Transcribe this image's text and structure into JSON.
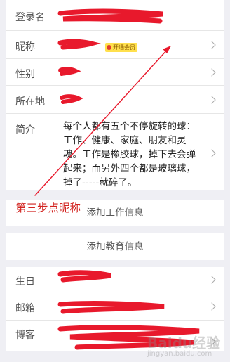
{
  "profile": {
    "login": {
      "label": "登录名"
    },
    "nickname": {
      "label": "昵称",
      "vip_badge": "开通会员"
    },
    "gender": {
      "label": "性别"
    },
    "location": {
      "label": "所在地"
    },
    "bio": {
      "label": "简介",
      "text": "每个人都有五个不停旋转的球：工作、健康、家庭、朋友和灵魂。工作是橡胶球，掉下去会弹起来；而另外四个都是玻璃球，掉了-----就碎了。"
    }
  },
  "actions": {
    "add_work": "添加工作信息",
    "add_education": "添加教育信息"
  },
  "details": {
    "birthday": {
      "label": "生日"
    },
    "email": {
      "label": "邮箱"
    },
    "blog": {
      "label": "博客"
    }
  },
  "annotation": {
    "text": "第三步点昵称",
    "color": "#d2231f"
  },
  "watermark": {
    "text": "Baidu经验",
    "sub": "jingyan.baidu.com"
  },
  "colors": {
    "background": "#efeff4",
    "scribble": "#e8192c"
  },
  "icons": {
    "chevron": "chevron-right-icon",
    "vip": "crown-icon"
  }
}
